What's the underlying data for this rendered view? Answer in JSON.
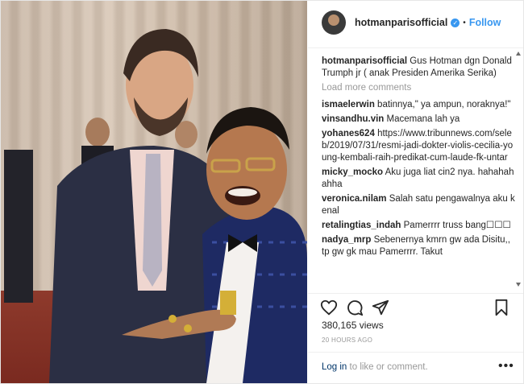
{
  "header": {
    "username": "hotmanparisofficial",
    "verified_icon": "✓",
    "separator": "•",
    "follow_label": "Follow"
  },
  "caption": {
    "user": "hotmanparisofficial",
    "text": "Gus Hotman dgn Donald Trumph jr ( anak Presiden Amerika Serika)"
  },
  "load_more": "Load more comments",
  "comments": [
    {
      "user": "ismaelerwin",
      "text": "batinnya,\" ya ampun, noraknya!\""
    },
    {
      "user": "vinsandhu.vin",
      "text": "Macemana lah ya"
    },
    {
      "user": "yohanes624",
      "text": "https://www.tribunnews.com/seleb/2019/07/31/resmi-jadi-dokter-violis-cecilia-young-kembali-raih-predikat-cum-laude-fk-untar"
    },
    {
      "user": "micky_mocko",
      "text": "Aku juga liat cin2 nya. hahahahahha"
    },
    {
      "user": "veronica.nilam",
      "text": "Salah satu pengawalnya aku kenal"
    },
    {
      "user": "retalingtias_indah",
      "text": "Pamerrrr truss bang☐☐☐"
    },
    {
      "user": "nadya_mrp",
      "text": "Sebenernya kmrn gw ada Disitu,, tp gw gk mau Pamerrrr. Takut"
    }
  ],
  "likes": "380,165 views",
  "age": "20 HOURS AGO",
  "footer": {
    "login_link": "Log in",
    "login_rest": " to like or comment.",
    "more_label": "•••"
  },
  "icons": {
    "like": "heart-icon",
    "comment": "comment-icon",
    "share": "share-icon",
    "save": "bookmark-icon"
  },
  "colors": {
    "accent": "#3897f0",
    "muted": "#999999",
    "text": "#262626"
  }
}
